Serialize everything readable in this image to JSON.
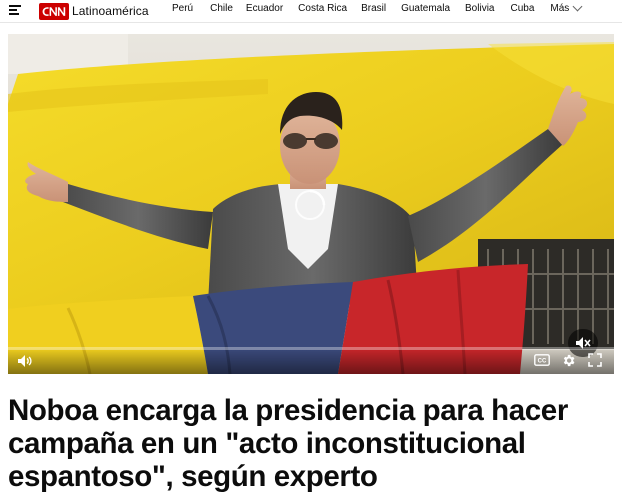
{
  "header": {
    "logo_text": "CNN",
    "edition": "Latinoamérica",
    "nav_items": [
      {
        "label": "Perú"
      },
      {
        "label": "Chile"
      },
      {
        "label": "Ecuador"
      },
      {
        "label": "Costa Rica"
      },
      {
        "label": "Brasil"
      },
      {
        "label": "Guatemala"
      },
      {
        "label": "Bolivia"
      },
      {
        "label": "Cuba"
      }
    ],
    "more_label": "Más"
  },
  "video": {
    "progress_fraction": 0.0,
    "icons": [
      "volume-icon",
      "mute-icon",
      "closed-captions-icon",
      "settings-gear-icon",
      "fullscreen-icon",
      "loading-spinner-icon"
    ]
  },
  "article": {
    "headline": "Noboa encarga la presidencia para hacer campaña en un \"acto inconstitucional espantoso\", según experto"
  },
  "colors": {
    "brand_red": "#cc0000",
    "headline": "#0c0c0c",
    "flag_yellow": "#f3d21c",
    "flag_blue": "#3a4a7a",
    "flag_red": "#c8262a"
  }
}
